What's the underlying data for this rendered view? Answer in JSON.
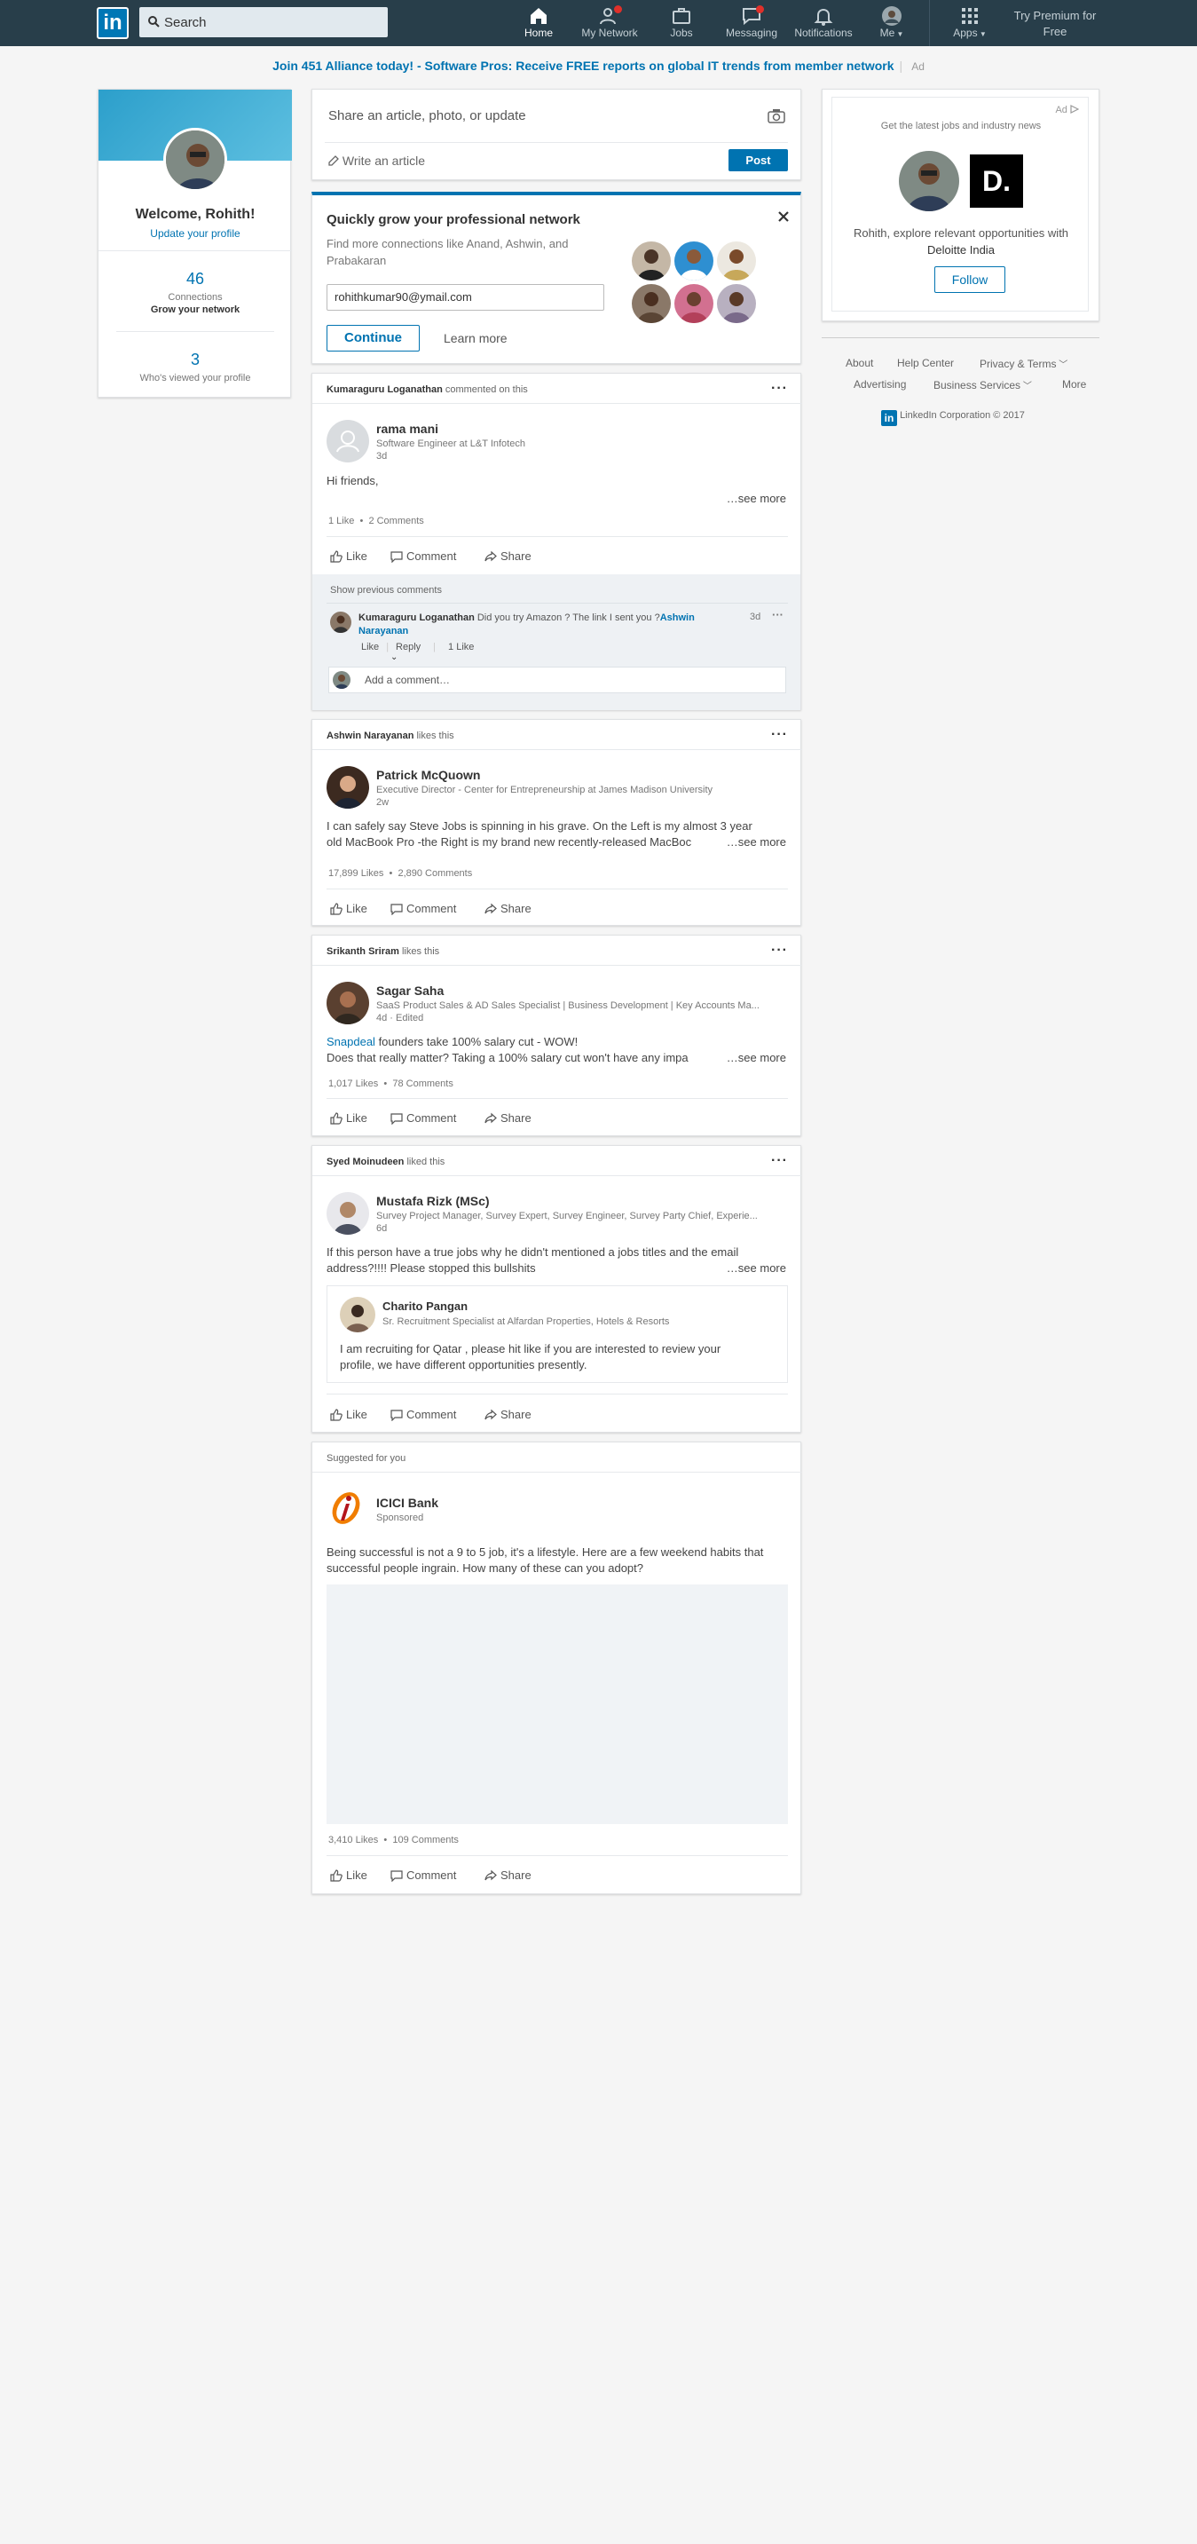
{
  "nav": {
    "logo": "in",
    "search_placeholder": "Search",
    "items": [
      {
        "label": "Home"
      },
      {
        "label": "My Network"
      },
      {
        "label": "Jobs"
      },
      {
        "label": "Messaging"
      },
      {
        "label": "Notifications"
      },
      {
        "label": "Me"
      },
      {
        "label": "Apps"
      }
    ],
    "premium_line1": "Try Premium for",
    "premium_line2": "Free"
  },
  "banner": {
    "text": "Join 451 Alliance today! - Software Pros: Receive FREE reports on global IT trends from member network",
    "ad": "Ad"
  },
  "profile": {
    "welcome": "Welcome, Rohith!",
    "update": "Update your profile",
    "connections_count": "46",
    "connections_label": "Connections",
    "grow": "Grow your network",
    "views_count": "3",
    "views_label": "Who's viewed your profile"
  },
  "share": {
    "placeholder": "Share an article, photo, or update",
    "write_article": "Write an article",
    "post": "Post"
  },
  "grow_card": {
    "title": "Quickly grow your professional network",
    "desc": "Find more connections like Anand, Ashwin, and Prabakaran",
    "email": "rohithkumar90@ymail.com",
    "continue": "Continue",
    "learn_more": "Learn more"
  },
  "actions": {
    "like": "Like",
    "comment": "Comment",
    "share": "Share"
  },
  "posts": [
    {
      "header_name": "Kumaraguru Loganathan",
      "header_action": "commented on this",
      "author": "rama mani",
      "subtitle": "Software Engineer at L&T Infotech",
      "time": "3d",
      "text": "Hi friends,",
      "see_more": "…see more",
      "likes": "1 Like",
      "comments": "2 Comments",
      "show_previous": "Show previous comments",
      "comment_author": "Kumaraguru Loganathan",
      "comment_text": "Did you try Amazon ? The link I sent you ?",
      "comment_mention": "Ashwin Narayanan",
      "comment_time": "3d",
      "comment_like": "Like",
      "comment_reply": "Reply",
      "comment_likes": "1 Like",
      "add_comment": "Add a comment…"
    },
    {
      "header_name": "Ashwin Narayanan",
      "header_action": "likes this",
      "author": "Patrick McQuown",
      "subtitle": "Executive Director - Center for Entrepreneurship at James Madison University",
      "time": "2w",
      "text1": "I can safely say Steve Jobs is spinning in his grave. On the Left is my almost 3 year",
      "text2": "old MacBook Pro -the Right is my brand new recently-released MacBoc",
      "see_more": "…see more",
      "likes": "17,899 Likes",
      "comments": "2,890 Comments"
    },
    {
      "header_name": "Srikanth Sriram",
      "header_action": "likes this",
      "author": "Sagar Saha",
      "subtitle": "SaaS Product Sales & AD Sales Specialist | Business Development | Key Accounts Ma...",
      "time": "4d · Edited",
      "link": "Snapdeal",
      "text1": " founders take 100% salary cut - WOW!",
      "text2": "Does that really matter? Taking a 100% salary cut won't have any impa",
      "see_more": "…see more",
      "likes": "1,017 Likes",
      "comments": "78 Comments"
    },
    {
      "header_name": "Syed Moinudeen",
      "header_action": "liked this",
      "author": "Mustafa Rizk (MSc)",
      "subtitle": "Survey Project Manager, Survey Expert, Survey Engineer, Survey Party Chief, Experie...",
      "time": "6d",
      "text1": "If this person have a true jobs why he didn't mentioned a jobs titles and the email",
      "text2": "address?!!!! Please stopped this bullshits",
      "see_more": "…see more",
      "quote_author": "Charito Pangan",
      "quote_sub": "Sr. Recruitment Specialist at Alfardan Properties, Hotels & Resorts",
      "quote_text1": "I am recruiting for Qatar , please hit like if you are interested to review your",
      "quote_text2": "profile, we have different opportunities presently."
    },
    {
      "header_name": "",
      "header_action": "Suggested for you",
      "author": "ICICI Bank",
      "subtitle": "Sponsored",
      "text1": "Being successful is not a 9 to 5 job, it's a lifestyle. Here are a few weekend habits that",
      "text2": "successful people ingrain. How many of these can you adopt?",
      "likes": "3,410 Likes",
      "comments": "109 Comments"
    }
  ],
  "right_ad": {
    "ad": "Ad",
    "tagline": "Get the latest jobs and industry news",
    "text": "Rohith, explore relevant opportunities with",
    "company": "Deloitte India",
    "logo": "D.",
    "follow": "Follow"
  },
  "footer": {
    "about": "About",
    "help": "Help Center",
    "privacy": "Privacy & Terms",
    "advertising": "Advertising",
    "business": "Business Services",
    "more": "More",
    "corp": "LinkedIn Corporation © 2017"
  }
}
